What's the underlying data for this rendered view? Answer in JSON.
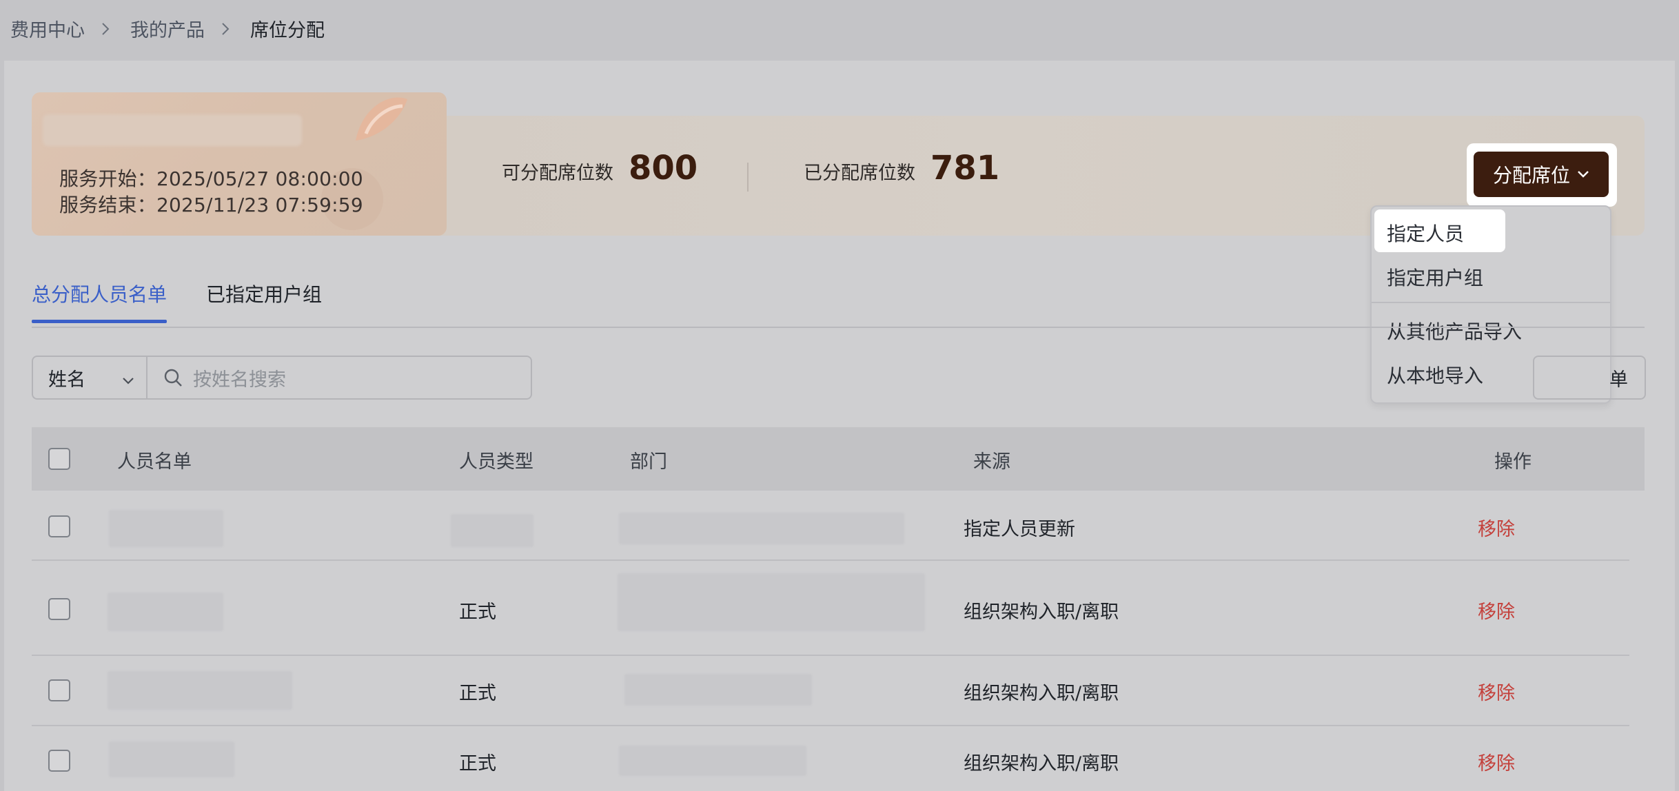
{
  "breadcrumb": {
    "items": [
      "费用中心",
      "我的产品",
      "席位分配"
    ]
  },
  "service": {
    "start": "服务开始：2025/05/27 08:00:00",
    "end": "服务结束：2025/11/23 07:59:59"
  },
  "stats": {
    "available_label": "可分配席位数",
    "available_value": "800",
    "assigned_label": "已分配席位数",
    "assigned_value": "781"
  },
  "allocate_button": {
    "label": "分配席位"
  },
  "allocate_menu": {
    "items": [
      "指定人员",
      "指定用户组",
      "从其他产品导入",
      "从本地导入"
    ]
  },
  "tabs": [
    "总分配人员名单",
    "已指定用户组"
  ],
  "filter": {
    "field": "姓名",
    "placeholder": "按姓名搜索",
    "export_partial": "单"
  },
  "table": {
    "columns": [
      "人员名单",
      "人员类型",
      "部门",
      "来源",
      "操作"
    ],
    "rows": [
      {
        "name": "",
        "type": "",
        "dept": "",
        "source": "指定人员更新",
        "action": "移除"
      },
      {
        "name": "",
        "type": "正式",
        "dept": "",
        "source": "组织架构入职/离职",
        "action": "移除"
      },
      {
        "name": "",
        "type": "正式",
        "dept": "",
        "source": "组织架构入职/离职",
        "action": "移除"
      },
      {
        "name": "",
        "type": "正式",
        "dept": "",
        "source": "组织架构入职/离职",
        "action": "移除"
      }
    ]
  },
  "colors": {
    "accent": "#3a5fc8",
    "primary_button": "#3c1d0f",
    "danger": "#c4403b",
    "overlay": "#cfcfd1"
  }
}
